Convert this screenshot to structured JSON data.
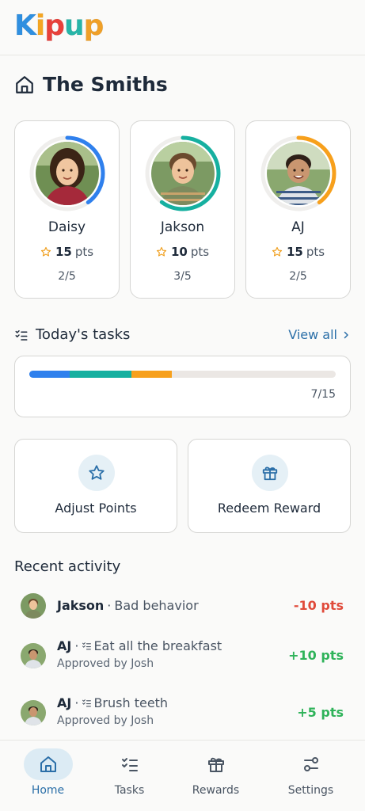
{
  "app": {
    "logo_text": "Kipup",
    "logo_colors": [
      "#2f8fe0",
      "#f5a623",
      "#e8403a",
      "#27b5a8",
      "#f0a028"
    ]
  },
  "family": {
    "title": "The Smiths",
    "icon": "home-icon"
  },
  "kids": [
    {
      "name": "Daisy",
      "points": "15",
      "points_unit": "pts",
      "progress_text": "2/5",
      "progress": 0.4,
      "ring_color": "#2f80ed"
    },
    {
      "name": "Jakson",
      "points": "10",
      "points_unit": "pts",
      "progress_text": "3/5",
      "progress": 0.6,
      "ring_color": "#16b0a0"
    },
    {
      "name": "AJ",
      "points": "15",
      "points_unit": "pts",
      "progress_text": "2/5",
      "progress": 0.4,
      "ring_color": "#f7a01c"
    }
  ],
  "tasks_section": {
    "title": "Today's tasks",
    "view_all": "View all",
    "progress_text": "7/15",
    "segments": [
      {
        "color": "#2f80ed",
        "fraction": 0.133
      },
      {
        "color": "#16b0a0",
        "fraction": 0.2
      },
      {
        "color": "#f7a01c",
        "fraction": 0.133
      }
    ]
  },
  "actions": [
    {
      "label": "Adjust Points",
      "icon": "star-icon"
    },
    {
      "label": "Redeem Reward",
      "icon": "gift-icon"
    }
  ],
  "recent": {
    "title": "Recent activity",
    "items": [
      {
        "name": "Jakson",
        "separator": "·",
        "description": "Bad behavior",
        "sub": "",
        "points": "-10 pts",
        "color": "#e04a3a"
      },
      {
        "name": "AJ",
        "separator": "·",
        "description": "Eat all the breakfast",
        "sub": "Approved by Josh",
        "points": "+10 pts",
        "color": "#2fb35a"
      },
      {
        "name": "AJ",
        "separator": "·",
        "description": "Brush teeth",
        "sub": "Approved by Josh",
        "points": "+5 pts",
        "color": "#2fb35a"
      }
    ]
  },
  "nav": [
    {
      "label": "Home",
      "icon": "home-icon",
      "active": true
    },
    {
      "label": "Tasks",
      "icon": "tasks-icon",
      "active": false
    },
    {
      "label": "Rewards",
      "icon": "gift-icon",
      "active": false
    },
    {
      "label": "Settings",
      "icon": "sliders-icon",
      "active": false
    }
  ],
  "colors": {
    "accent": "#2b6fa8",
    "active_pill": "#dcebf4"
  }
}
